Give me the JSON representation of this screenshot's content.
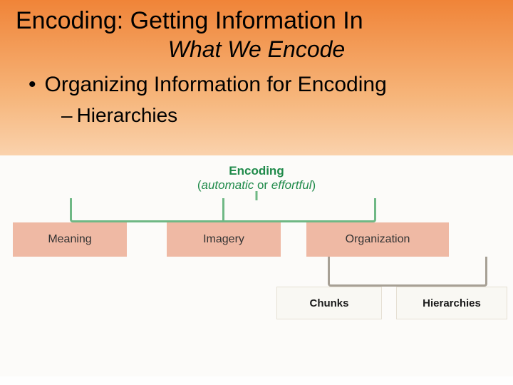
{
  "slide": {
    "title": "Encoding: Getting Information In",
    "subtitle": "What We Encode",
    "bullet": "Organizing Information for Encoding",
    "sub_bullet": "Hierarchies"
  },
  "diagram": {
    "top": {
      "line1": "Encoding",
      "line2_left": "automatic",
      "line2_mid": " or ",
      "line2_right": "effortful",
      "paren_open": "(",
      "paren_close": ")"
    },
    "row1": {
      "meaning": "Meaning",
      "imagery": "Imagery",
      "organization": "Organization"
    },
    "row2": {
      "chunks": "Chunks",
      "hierarchies": "Hierarchies"
    }
  }
}
